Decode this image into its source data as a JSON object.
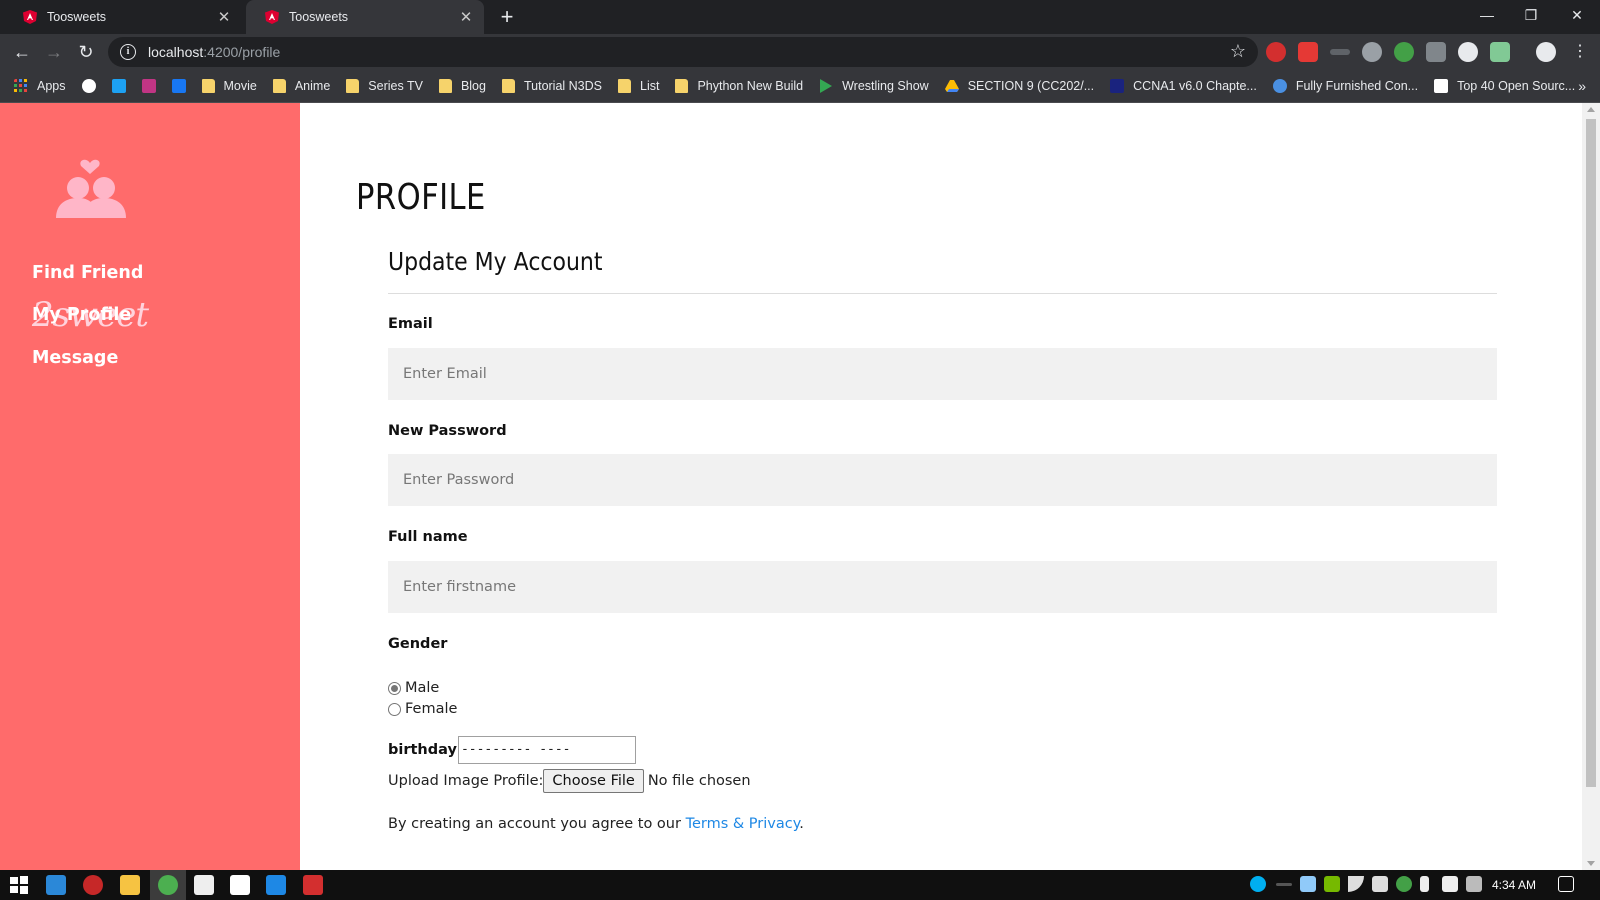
{
  "browser": {
    "tabs": [
      {
        "title": "Toosweets",
        "active": false
      },
      {
        "title": "Toosweets",
        "active": true
      }
    ],
    "url_host": "localhost",
    "url_path": ":4200/profile",
    "bookmarks": [
      {
        "label": "Apps",
        "icon": "apps-grid-icon"
      },
      {
        "label": "",
        "icon": "google-icon"
      },
      {
        "label": "",
        "icon": "twitter-icon"
      },
      {
        "label": "",
        "icon": "instagram-icon"
      },
      {
        "label": "",
        "icon": "facebook-icon"
      },
      {
        "label": "Movie",
        "icon": "folder-icon"
      },
      {
        "label": "Anime",
        "icon": "folder-icon"
      },
      {
        "label": "Series TV",
        "icon": "folder-icon"
      },
      {
        "label": "Blog",
        "icon": "folder-icon"
      },
      {
        "label": "Tutorial N3DS",
        "icon": "folder-icon"
      },
      {
        "label": "List",
        "icon": "folder-icon"
      },
      {
        "label": "Phython New Build",
        "icon": "folder-icon"
      },
      {
        "label": "Wrestling Show",
        "icon": "play-store-icon"
      },
      {
        "label": "SECTION 9 (CC202/...",
        "icon": "drive-icon"
      },
      {
        "label": "CCNA1 v6.0 Chapte...",
        "icon": "ccna-icon"
      },
      {
        "label": "Fully Furnished Con...",
        "icon": "plus-circle-icon"
      },
      {
        "label": "Top 40 Open Sourc...",
        "icon": "p-icon"
      }
    ],
    "bookmarks_more": "»"
  },
  "sidebar": {
    "logo_text": "2sweet",
    "nav": [
      {
        "label": "Find Friend"
      },
      {
        "label": "My Profile"
      },
      {
        "label": "Message"
      }
    ]
  },
  "main": {
    "page_title": "PROFILE",
    "section_title": "Update My Account",
    "email": {
      "label": "Email",
      "placeholder": "Enter Email",
      "value": ""
    },
    "password": {
      "label": "New Password",
      "placeholder": "Enter Password",
      "value": ""
    },
    "fullname": {
      "label": "Full name",
      "placeholder": "Enter firstname",
      "value": ""
    },
    "gender": {
      "label": "Gender",
      "options": [
        {
          "label": "Male",
          "selected": true
        },
        {
          "label": "Female",
          "selected": false
        }
      ]
    },
    "birthday": {
      "label": "birthday",
      "value": "--------- ----"
    },
    "upload": {
      "label": "Upload Image Profile:",
      "button": "Choose File",
      "status": "No file chosen"
    },
    "terms": {
      "prefix": "By creating an account you agree to our ",
      "link": "Terms & Privacy",
      "suffix": "."
    }
  },
  "taskbar": {
    "clock": "4:34 AM"
  },
  "colors": {
    "sidebar_bg": "#ff6b6b",
    "link": "#1e88e5",
    "field_bg": "#f1f1f1",
    "chrome_dark": "#202124",
    "chrome_toolbar": "#35363a"
  }
}
